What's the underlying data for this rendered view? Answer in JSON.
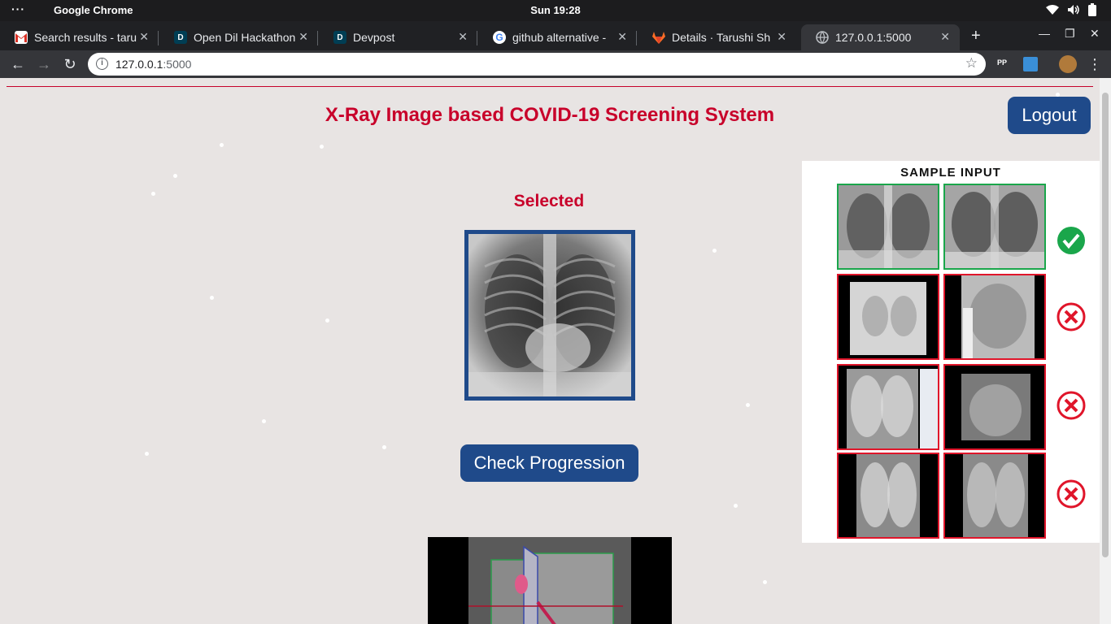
{
  "os": {
    "app_name": "Google Chrome",
    "clock": "Sun 19:28"
  },
  "browser": {
    "tabs": [
      {
        "title": "Search results - taru",
        "icon": "gmail-icon",
        "active": false
      },
      {
        "title": "Open Dil Hackathon",
        "icon": "devpost-icon",
        "active": false
      },
      {
        "title": "Devpost",
        "icon": "devpost-icon",
        "active": false
      },
      {
        "title": "github alternative -",
        "icon": "google-icon",
        "active": false
      },
      {
        "title": "Details · Tarushi Sh",
        "icon": "gitlab-icon",
        "active": false
      },
      {
        "title": "127.0.0.1:5000",
        "icon": "globe-icon",
        "active": true
      }
    ],
    "url_host": "127.0.0.1",
    "url_port": ":5000",
    "extension_label": "PP"
  },
  "page": {
    "title": "X-Ray Image based COVID-19 Screening System",
    "logout_label": "Logout",
    "selected_label": "Selected",
    "check_button_label": "Check Progression",
    "sample_title": "SAMPLE INPUT"
  },
  "colors": {
    "accent_red": "#c8002a",
    "button_blue": "#1f4a8a",
    "ok_green": "#1aa64b",
    "bad_red": "#e0152a"
  }
}
